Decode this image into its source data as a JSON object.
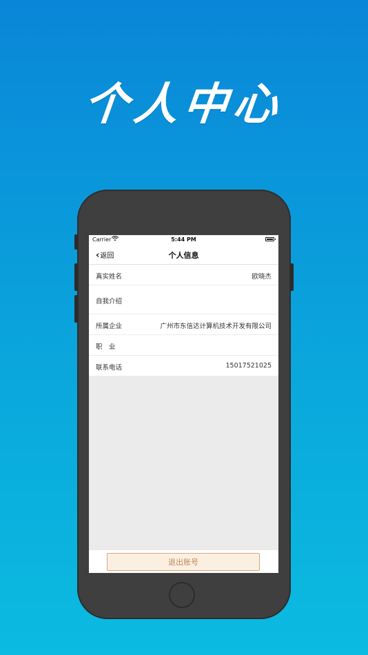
{
  "banner": {
    "title": "个人中心"
  },
  "status_bar": {
    "carrier": "Carrier",
    "time": "5:44 PM",
    "wifi_icon": "wifi-icon",
    "battery_icon": "battery-icon"
  },
  "nav": {
    "back_label": "返回",
    "title": "个人信息"
  },
  "rows": [
    {
      "label": "真实姓名",
      "value": "欧晓杰"
    },
    {
      "label": "自我介绍",
      "value": ""
    },
    {
      "label": "所属企业",
      "value": "广州市东信达计算机技术开发有限公司"
    },
    {
      "label": "职　业",
      "value": ""
    },
    {
      "label": "联系电话",
      "value": "15017521025"
    }
  ],
  "footer": {
    "logout_label": "退出账号"
  },
  "colors": {
    "background_top": "#0a86d8",
    "background_bottom": "#0bbbe0",
    "logout_border": "#d7a978",
    "logout_fill": "#fbefe2"
  }
}
